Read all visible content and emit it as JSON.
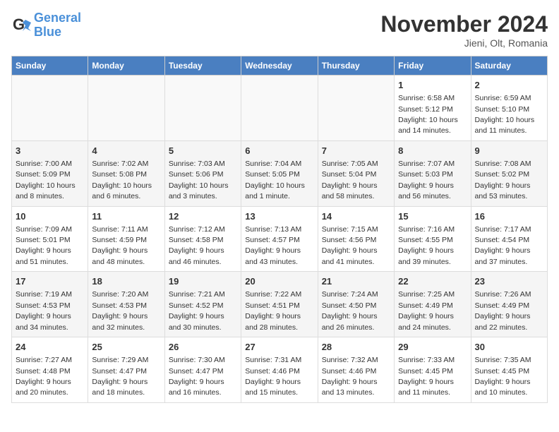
{
  "logo": {
    "line1": "General",
    "line2": "Blue"
  },
  "title": "November 2024",
  "location": "Jieni, Olt, Romania",
  "weekdays": [
    "Sunday",
    "Monday",
    "Tuesday",
    "Wednesday",
    "Thursday",
    "Friday",
    "Saturday"
  ],
  "weeks": [
    [
      {
        "day": "",
        "info": ""
      },
      {
        "day": "",
        "info": ""
      },
      {
        "day": "",
        "info": ""
      },
      {
        "day": "",
        "info": ""
      },
      {
        "day": "",
        "info": ""
      },
      {
        "day": "1",
        "info": "Sunrise: 6:58 AM\nSunset: 5:12 PM\nDaylight: 10 hours and 14 minutes."
      },
      {
        "day": "2",
        "info": "Sunrise: 6:59 AM\nSunset: 5:10 PM\nDaylight: 10 hours and 11 minutes."
      }
    ],
    [
      {
        "day": "3",
        "info": "Sunrise: 7:00 AM\nSunset: 5:09 PM\nDaylight: 10 hours and 8 minutes."
      },
      {
        "day": "4",
        "info": "Sunrise: 7:02 AM\nSunset: 5:08 PM\nDaylight: 10 hours and 6 minutes."
      },
      {
        "day": "5",
        "info": "Sunrise: 7:03 AM\nSunset: 5:06 PM\nDaylight: 10 hours and 3 minutes."
      },
      {
        "day": "6",
        "info": "Sunrise: 7:04 AM\nSunset: 5:05 PM\nDaylight: 10 hours and 1 minute."
      },
      {
        "day": "7",
        "info": "Sunrise: 7:05 AM\nSunset: 5:04 PM\nDaylight: 9 hours and 58 minutes."
      },
      {
        "day": "8",
        "info": "Sunrise: 7:07 AM\nSunset: 5:03 PM\nDaylight: 9 hours and 56 minutes."
      },
      {
        "day": "9",
        "info": "Sunrise: 7:08 AM\nSunset: 5:02 PM\nDaylight: 9 hours and 53 minutes."
      }
    ],
    [
      {
        "day": "10",
        "info": "Sunrise: 7:09 AM\nSunset: 5:01 PM\nDaylight: 9 hours and 51 minutes."
      },
      {
        "day": "11",
        "info": "Sunrise: 7:11 AM\nSunset: 4:59 PM\nDaylight: 9 hours and 48 minutes."
      },
      {
        "day": "12",
        "info": "Sunrise: 7:12 AM\nSunset: 4:58 PM\nDaylight: 9 hours and 46 minutes."
      },
      {
        "day": "13",
        "info": "Sunrise: 7:13 AM\nSunset: 4:57 PM\nDaylight: 9 hours and 43 minutes."
      },
      {
        "day": "14",
        "info": "Sunrise: 7:15 AM\nSunset: 4:56 PM\nDaylight: 9 hours and 41 minutes."
      },
      {
        "day": "15",
        "info": "Sunrise: 7:16 AM\nSunset: 4:55 PM\nDaylight: 9 hours and 39 minutes."
      },
      {
        "day": "16",
        "info": "Sunrise: 7:17 AM\nSunset: 4:54 PM\nDaylight: 9 hours and 37 minutes."
      }
    ],
    [
      {
        "day": "17",
        "info": "Sunrise: 7:19 AM\nSunset: 4:53 PM\nDaylight: 9 hours and 34 minutes."
      },
      {
        "day": "18",
        "info": "Sunrise: 7:20 AM\nSunset: 4:53 PM\nDaylight: 9 hours and 32 minutes."
      },
      {
        "day": "19",
        "info": "Sunrise: 7:21 AM\nSunset: 4:52 PM\nDaylight: 9 hours and 30 minutes."
      },
      {
        "day": "20",
        "info": "Sunrise: 7:22 AM\nSunset: 4:51 PM\nDaylight: 9 hours and 28 minutes."
      },
      {
        "day": "21",
        "info": "Sunrise: 7:24 AM\nSunset: 4:50 PM\nDaylight: 9 hours and 26 minutes."
      },
      {
        "day": "22",
        "info": "Sunrise: 7:25 AM\nSunset: 4:49 PM\nDaylight: 9 hours and 24 minutes."
      },
      {
        "day": "23",
        "info": "Sunrise: 7:26 AM\nSunset: 4:49 PM\nDaylight: 9 hours and 22 minutes."
      }
    ],
    [
      {
        "day": "24",
        "info": "Sunrise: 7:27 AM\nSunset: 4:48 PM\nDaylight: 9 hours and 20 minutes."
      },
      {
        "day": "25",
        "info": "Sunrise: 7:29 AM\nSunset: 4:47 PM\nDaylight: 9 hours and 18 minutes."
      },
      {
        "day": "26",
        "info": "Sunrise: 7:30 AM\nSunset: 4:47 PM\nDaylight: 9 hours and 16 minutes."
      },
      {
        "day": "27",
        "info": "Sunrise: 7:31 AM\nSunset: 4:46 PM\nDaylight: 9 hours and 15 minutes."
      },
      {
        "day": "28",
        "info": "Sunrise: 7:32 AM\nSunset: 4:46 PM\nDaylight: 9 hours and 13 minutes."
      },
      {
        "day": "29",
        "info": "Sunrise: 7:33 AM\nSunset: 4:45 PM\nDaylight: 9 hours and 11 minutes."
      },
      {
        "day": "30",
        "info": "Sunrise: 7:35 AM\nSunset: 4:45 PM\nDaylight: 9 hours and 10 minutes."
      }
    ]
  ]
}
